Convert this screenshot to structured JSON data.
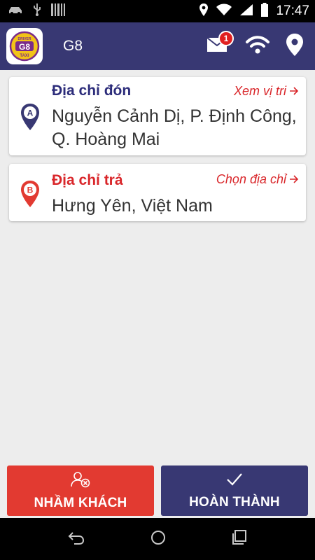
{
  "status_bar": {
    "time": "17:47"
  },
  "app_bar": {
    "title": "G8",
    "logo_text": "G8",
    "logo_subtext": "DRIVER",
    "logo_taxi": "TAXI",
    "notification_count": "1"
  },
  "pickup": {
    "pin_letter": "A",
    "label": "Địa chỉ đón",
    "link": "Xem vị tri",
    "address": "Nguyễn Cảnh Dị, P. Định Công, Q. Hoàng Mai"
  },
  "dropoff": {
    "pin_letter": "B",
    "label": "Địa chỉ trả",
    "link": "Chọn địa chỉ",
    "address": "Hưng Yên, Việt Nam"
  },
  "buttons": {
    "wrong_customer": "NHẦM KHÁCH",
    "complete": "HOÀN THÀNH"
  },
  "colors": {
    "primary": "#383873",
    "accent_red": "#e23a31",
    "label_blue": "#2c2c7a",
    "label_red": "#d9262a",
    "background": "#ededed"
  },
  "icons": [
    "car-icon",
    "usb-icon",
    "barcode-icon",
    "location-icon",
    "wifi-icon",
    "signal-icon",
    "battery-icon",
    "mail-icon",
    "wifi-icon",
    "location-icon",
    "pin-icon",
    "user-remove-icon",
    "check-icon",
    "back-icon",
    "home-icon",
    "recents-icon"
  ]
}
